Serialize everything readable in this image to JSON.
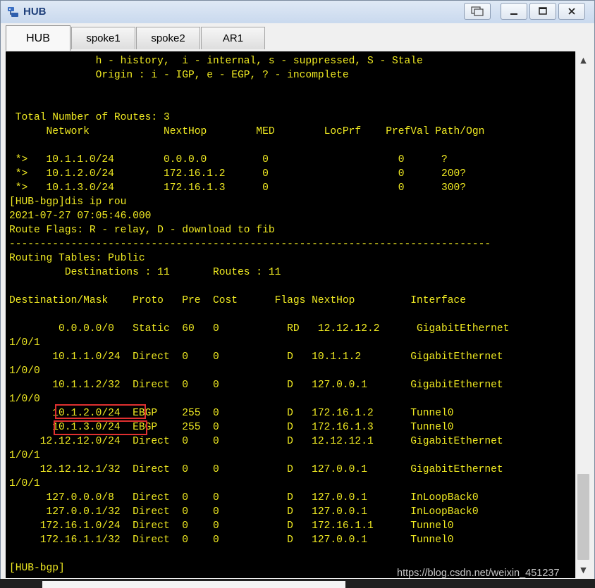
{
  "window": {
    "title": "HUB",
    "controls": [
      "restore-view",
      "minimize",
      "maximize",
      "close"
    ]
  },
  "tabs": [
    {
      "label": "HUB",
      "active": true
    },
    {
      "label": "spoke1",
      "active": false
    },
    {
      "label": "spoke2",
      "active": false
    },
    {
      "label": "AR1",
      "active": false
    }
  ],
  "terminal": {
    "lines": [
      "              h - history,  i - internal, s - suppressed, S - Stale",
      "              Origin : i - IGP, e - EGP, ? - incomplete",
      "",
      "",
      " Total Number of Routes: 3",
      "      Network            NextHop        MED        LocPrf    PrefVal Path/Ogn",
      "",
      " *>   10.1.1.0/24        0.0.0.0         0                     0      ?",
      " *>   10.1.2.0/24        172.16.1.2      0                     0      200?",
      " *>   10.1.3.0/24        172.16.1.3      0                     0      300?",
      "[HUB-bgp]dis ip rou",
      "2021-07-27 07:05:46.000",
      "Route Flags: R - relay, D - download to fib",
      "------------------------------------------------------------------------------",
      "Routing Tables: Public",
      "         Destinations : 11       Routes : 11",
      "",
      "Destination/Mask    Proto   Pre  Cost      Flags NextHop         Interface",
      "",
      "        0.0.0.0/0   Static  60   0           RD   12.12.12.2      GigabitEthernet",
      "1/0/1",
      "       10.1.1.0/24  Direct  0    0           D   10.1.1.2        GigabitEthernet",
      "1/0/0",
      "       10.1.1.2/32  Direct  0    0           D   127.0.0.1       GigabitEthernet",
      "1/0/0",
      "       10.1.2.0/24  EBGP    255  0           D   172.16.1.2      Tunnel0",
      "       10.1.3.0/24  EBGP    255  0           D   172.16.1.3      Tunnel0",
      "     12.12.12.0/24  Direct  0    0           D   12.12.12.1      GigabitEthernet",
      "1/0/1",
      "     12.12.12.1/32  Direct  0    0           D   127.0.0.1       GigabitEthernet",
      "1/0/1",
      "      127.0.0.0/8   Direct  0    0           D   127.0.0.1       InLoopBack0",
      "      127.0.0.1/32  Direct  0    0           D   127.0.0.1       InLoopBack0",
      "     172.16.1.0/24  Direct  0    0           D   172.16.1.1      Tunnel0",
      "     172.16.1.1/32  Direct  0    0           D   127.0.0.1       Tunnel0",
      "",
      "[HUB-bgp]"
    ],
    "text_color": "#f0ea22",
    "background": "#000000",
    "highlight_color": "#e03030"
  },
  "watermark": "https://blog.csdn.net/weixin_451237"
}
